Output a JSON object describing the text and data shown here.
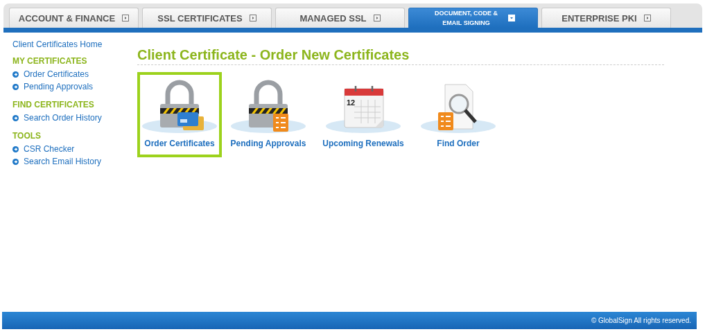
{
  "tabs": [
    {
      "label": "ACCOUNT & FINANCE",
      "selected": false
    },
    {
      "label": "SSL CERTIFICATES",
      "selected": false
    },
    {
      "label": "MANAGED SSL",
      "selected": false
    },
    {
      "label": "DOCUMENT, CODE & EMAIL SIGNING",
      "selected": true
    },
    {
      "label": "ENTERPRISE PKI",
      "selected": false
    }
  ],
  "sidebar": {
    "home_link": "Client Certificates Home",
    "sections": [
      {
        "title": "MY CERTIFICATES",
        "items": [
          "Order Certificates",
          "Pending Approvals"
        ]
      },
      {
        "title": "FIND CERTIFICATES",
        "items": [
          "Search Order History"
        ]
      },
      {
        "title": "TOOLS",
        "items": [
          "CSR Checker",
          "Search Email History"
        ]
      }
    ]
  },
  "page_title": "Client Certificate - Order New Certificates",
  "tiles": [
    {
      "label": "Order Certificates",
      "kind": "lock-cards",
      "selected": true
    },
    {
      "label": "Pending Approvals",
      "kind": "lock-list",
      "selected": false
    },
    {
      "label": "Upcoming Renewals",
      "kind": "calendar",
      "selected": false,
      "day": "12"
    },
    {
      "label": "Find Order",
      "kind": "search-document",
      "selected": false
    }
  ],
  "footer": "© GlobalSign All rights reserved."
}
